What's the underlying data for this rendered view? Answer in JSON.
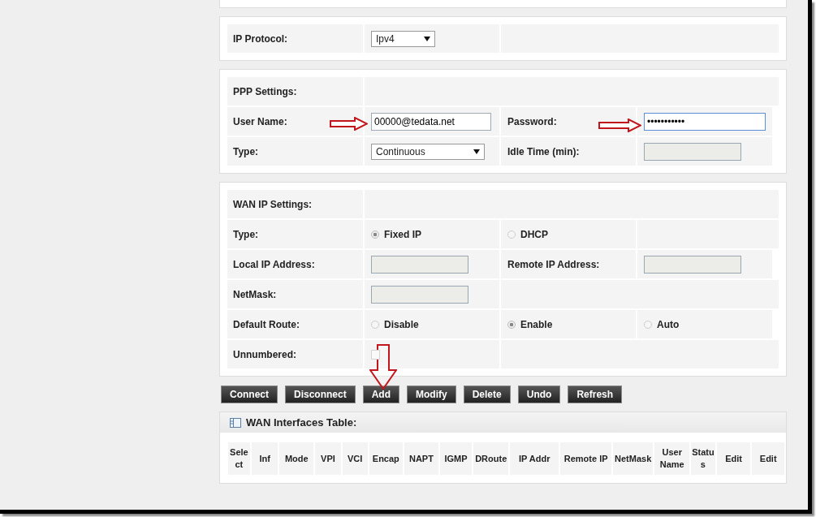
{
  "sections": [
    {
      "rows": [
        [
          {
            "kind": "label",
            "text": "IP Protocol:"
          },
          {
            "kind": "select",
            "value": "Ipv4",
            "wide": false
          },
          {
            "kind": "blank"
          }
        ]
      ]
    },
    {
      "rows": [
        [
          {
            "kind": "label",
            "text": "PPP Settings:"
          },
          {
            "kind": "blank"
          }
        ],
        [
          {
            "kind": "label",
            "text": "User Name:"
          },
          {
            "kind": "input",
            "value": "00000@tedata.net",
            "disabled": false,
            "focused": false
          },
          {
            "kind": "label",
            "text": "Password:"
          },
          {
            "kind": "input",
            "value": "•••••••••••",
            "disabled": false,
            "focused": true
          }
        ],
        [
          {
            "kind": "label",
            "text": "Type:"
          },
          {
            "kind": "select",
            "value": "Continuous",
            "wide": true
          },
          {
            "kind": "label",
            "text": "Idle Time (min):"
          },
          {
            "kind": "input",
            "disabled": true,
            "focused": false
          }
        ]
      ]
    },
    {
      "rows": [
        [
          {
            "kind": "label",
            "text": "WAN IP Settings:"
          },
          {
            "kind": "blank"
          }
        ],
        [
          {
            "kind": "label",
            "text": "Type:"
          },
          {
            "kind": "radio",
            "label": "Fixed IP",
            "selected": true
          },
          {
            "kind": "radio",
            "label": "DHCP",
            "selected": false
          },
          {
            "kind": "blank"
          }
        ],
        [
          {
            "kind": "label",
            "text": "Local IP Address:"
          },
          {
            "kind": "input",
            "disabled": true,
            "focused": false
          },
          {
            "kind": "label",
            "text": "Remote IP Address:"
          },
          {
            "kind": "input",
            "disabled": true,
            "focused": false
          }
        ],
        [
          {
            "kind": "label",
            "text": "NetMask:"
          },
          {
            "kind": "input",
            "disabled": true,
            "focused": false
          },
          {
            "kind": "blank"
          }
        ],
        [
          {
            "kind": "label",
            "text": "Default Route:"
          },
          {
            "kind": "radio",
            "label": "Disable",
            "selected": false
          },
          {
            "kind": "radio",
            "label": "Enable",
            "selected": true
          },
          {
            "kind": "radio",
            "label": "Auto",
            "selected": false
          }
        ],
        [
          {
            "kind": "label",
            "text": "Unnumbered:"
          },
          {
            "kind": "checkbox",
            "checked": false
          },
          {
            "kind": "blank"
          }
        ]
      ]
    }
  ],
  "buttons": [
    "Connect",
    "Disconnect",
    "Add",
    "Modify",
    "Delete",
    "Undo",
    "Refresh"
  ],
  "table": {
    "title": "WAN Interfaces Table:",
    "columns": [
      "Select",
      "Inf",
      "Mode",
      "VPI",
      "VCI",
      "Encap",
      "NAPT",
      "IGMP",
      "DRoute",
      "IP Addr",
      "Remote IP",
      "NetMask",
      "User Name",
      "Status",
      "Edit",
      "Edit"
    ]
  }
}
